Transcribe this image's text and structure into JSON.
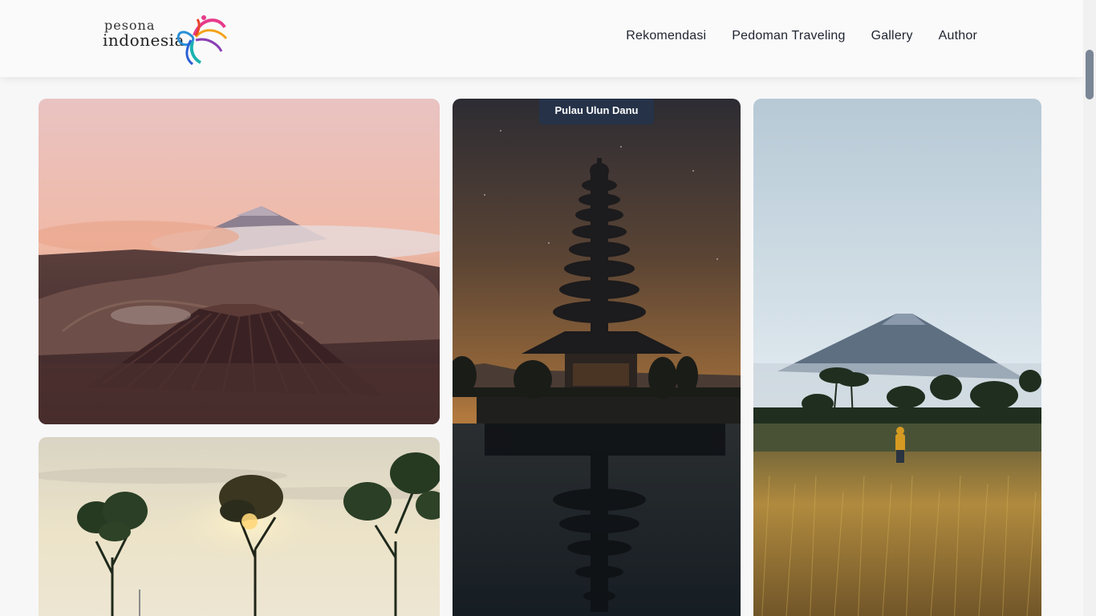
{
  "header": {
    "logo": {
      "small": "pesona",
      "big": "indonesia"
    },
    "nav": [
      {
        "label": "Rekomendasi"
      },
      {
        "label": "Pedoman Traveling"
      },
      {
        "label": "Gallery"
      },
      {
        "label": "Author"
      }
    ]
  },
  "gallery": {
    "cards": [
      {
        "id": "bromo"
      },
      {
        "id": "ulun-danu",
        "caption": "Pulau Ulun Danu"
      },
      {
        "id": "rice-field"
      },
      {
        "id": "trees-sunset"
      }
    ]
  },
  "colors": {
    "nav_text": "#1f2430",
    "caption_bg": "#253248",
    "page_bg": "#f7f7f8"
  }
}
